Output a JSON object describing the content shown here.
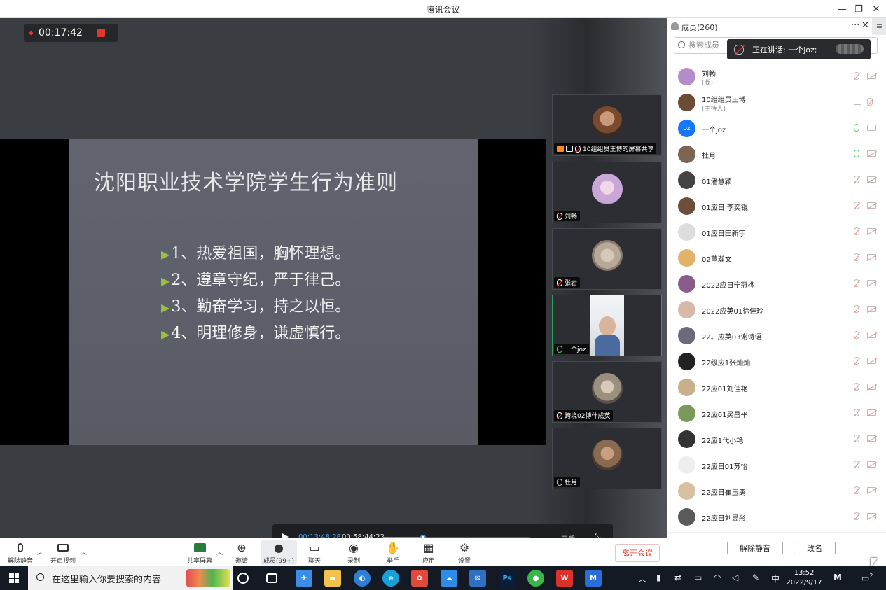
{
  "window": {
    "title": "腾讯会议"
  },
  "recording": {
    "time": "00:17:42"
  },
  "slide": {
    "title": "沈阳职业技术学院学生行为准则",
    "bullets": [
      "1、热爱祖国，胸怀理想。",
      "2、遵章守纪，严于律己。",
      "3、勤奋学习，持之以恒。",
      "4、明理修身，谦虚慎行。"
    ],
    "bullet_marker": "▶"
  },
  "thumbnails": [
    {
      "label": "10组组员王博的屏幕共享",
      "mic": "off",
      "avatar_color": "#7a4a2e"
    },
    {
      "label": "刘畅",
      "mic": "off",
      "avatar_color": "#c9a7d6"
    },
    {
      "label": "张岩",
      "mic": "off",
      "avatar_color": "#b8a89a"
    },
    {
      "label": "一个joz",
      "mic": "on",
      "avatar_color": "#e8ecef"
    },
    {
      "label": "跨境02博什成英",
      "mic": "off",
      "avatar_color": "#9a9080"
    },
    {
      "label": "杜月",
      "mic": "on",
      "avatar_color": "#8a6a50"
    }
  ],
  "player": {
    "current": "00:13:48:23",
    "separator": "/",
    "total": "00:58:44:22",
    "progress": 0.27,
    "quality": "画质 ▾"
  },
  "toolbar": {
    "unmute": "解除静音",
    "video": "开启视频",
    "share": "共享屏幕",
    "invite": "邀请",
    "members": "成员(99+)",
    "chat": "聊天",
    "record": "录制",
    "raise_hand": "举手",
    "apps": "应用",
    "settings": "设置",
    "leave": "离开会议"
  },
  "panel": {
    "title": "成员(260)",
    "search_placeholder": "搜索成员",
    "toast": "正在讲话: 一个joz;",
    "members": [
      {
        "name": "刘畅",
        "role": "(我)",
        "mic": "off",
        "cam": "off",
        "color": "#b48cc7"
      },
      {
        "name": "10组组员王博",
        "role": "(主持人)",
        "mic": "off",
        "cam": "share",
        "color": "#6b4a36"
      },
      {
        "name": "一个joz",
        "role": "",
        "mic": "on",
        "cam": "on",
        "color": "#1677ff",
        "initials": "oz"
      },
      {
        "name": "杜月",
        "role": "",
        "mic": "on",
        "cam": "off",
        "color": "#7d6552"
      },
      {
        "name": "01潘慧颖",
        "role": "",
        "mic": "off",
        "cam": "off",
        "color": "#444"
      },
      {
        "name": "01应日 李奕锟",
        "role": "",
        "mic": "off",
        "cam": "off",
        "color": "#6b4f3a"
      },
      {
        "name": "01应日田新宇",
        "role": "",
        "mic": "off",
        "cam": "off",
        "color": "#ddd"
      },
      {
        "name": "02董瀚文",
        "role": "",
        "mic": "off",
        "cam": "off",
        "color": "#e0b26a"
      },
      {
        "name": "2022应日宁冠桦",
        "role": "",
        "mic": "off",
        "cam": "off",
        "color": "#8a5c8c"
      },
      {
        "name": "2022应英01徐佳玲",
        "role": "",
        "mic": "off",
        "cam": "off",
        "color": "#d8b8a8"
      },
      {
        "name": "22。应英03谢诗语",
        "role": "",
        "mic": "off",
        "cam": "off",
        "color": "#6e6a7c"
      },
      {
        "name": "22级应1张灿灿",
        "role": "",
        "mic": "off",
        "cam": "off",
        "color": "#222"
      },
      {
        "name": "22应01刘佳艳",
        "role": "",
        "mic": "off",
        "cam": "off",
        "color": "#c8b08a"
      },
      {
        "name": "22应01吴昌平",
        "role": "",
        "mic": "off",
        "cam": "off",
        "color": "#7a9a5a"
      },
      {
        "name": "22应1代小艳",
        "role": "",
        "mic": "off",
        "cam": "off",
        "color": "#333"
      },
      {
        "name": "22应日01苏怡",
        "role": "",
        "mic": "off",
        "cam": "off",
        "color": "#eee"
      },
      {
        "name": "22应日崔玉鸽",
        "role": "",
        "mic": "off",
        "cam": "off",
        "color": "#d6c0a0"
      },
      {
        "name": "22应日刘昱彤",
        "role": "",
        "mic": "off",
        "cam": "off",
        "color": "#5a5a5a"
      }
    ],
    "mute_all": "解除静音",
    "rename": "改名"
  },
  "taskbar": {
    "search_placeholder": "在这里输入你要搜索的内容",
    "ime": "中",
    "time": "13:52",
    "date": "2022/9/17",
    "notifications": "2"
  }
}
